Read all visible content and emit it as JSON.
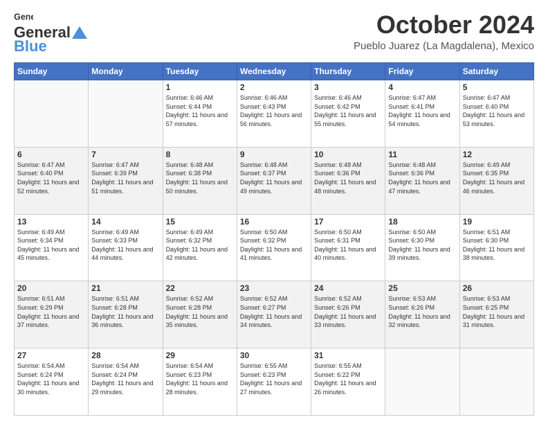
{
  "header": {
    "logo_general": "General",
    "logo_blue": "Blue",
    "month_title": "October 2024",
    "subtitle": "Pueblo Juarez (La Magdalena), Mexico"
  },
  "weekdays": [
    "Sunday",
    "Monday",
    "Tuesday",
    "Wednesday",
    "Thursday",
    "Friday",
    "Saturday"
  ],
  "weeks": [
    [
      {
        "day": "",
        "info": ""
      },
      {
        "day": "",
        "info": ""
      },
      {
        "day": "1",
        "info": "Sunrise: 6:46 AM\nSunset: 6:44 PM\nDaylight: 11 hours and 57 minutes."
      },
      {
        "day": "2",
        "info": "Sunrise: 6:46 AM\nSunset: 6:43 PM\nDaylight: 11 hours and 56 minutes."
      },
      {
        "day": "3",
        "info": "Sunrise: 6:46 AM\nSunset: 6:42 PM\nDaylight: 11 hours and 55 minutes."
      },
      {
        "day": "4",
        "info": "Sunrise: 6:47 AM\nSunset: 6:41 PM\nDaylight: 11 hours and 54 minutes."
      },
      {
        "day": "5",
        "info": "Sunrise: 6:47 AM\nSunset: 6:40 PM\nDaylight: 11 hours and 53 minutes."
      }
    ],
    [
      {
        "day": "6",
        "info": "Sunrise: 6:47 AM\nSunset: 6:40 PM\nDaylight: 11 hours and 52 minutes."
      },
      {
        "day": "7",
        "info": "Sunrise: 6:47 AM\nSunset: 6:39 PM\nDaylight: 11 hours and 51 minutes."
      },
      {
        "day": "8",
        "info": "Sunrise: 6:48 AM\nSunset: 6:38 PM\nDaylight: 11 hours and 50 minutes."
      },
      {
        "day": "9",
        "info": "Sunrise: 6:48 AM\nSunset: 6:37 PM\nDaylight: 11 hours and 49 minutes."
      },
      {
        "day": "10",
        "info": "Sunrise: 6:48 AM\nSunset: 6:36 PM\nDaylight: 11 hours and 48 minutes."
      },
      {
        "day": "11",
        "info": "Sunrise: 6:48 AM\nSunset: 6:36 PM\nDaylight: 11 hours and 47 minutes."
      },
      {
        "day": "12",
        "info": "Sunrise: 6:49 AM\nSunset: 6:35 PM\nDaylight: 11 hours and 46 minutes."
      }
    ],
    [
      {
        "day": "13",
        "info": "Sunrise: 6:49 AM\nSunset: 6:34 PM\nDaylight: 11 hours and 45 minutes."
      },
      {
        "day": "14",
        "info": "Sunrise: 6:49 AM\nSunset: 6:33 PM\nDaylight: 11 hours and 44 minutes."
      },
      {
        "day": "15",
        "info": "Sunrise: 6:49 AM\nSunset: 6:32 PM\nDaylight: 11 hours and 42 minutes."
      },
      {
        "day": "16",
        "info": "Sunrise: 6:50 AM\nSunset: 6:32 PM\nDaylight: 11 hours and 41 minutes."
      },
      {
        "day": "17",
        "info": "Sunrise: 6:50 AM\nSunset: 6:31 PM\nDaylight: 11 hours and 40 minutes."
      },
      {
        "day": "18",
        "info": "Sunrise: 6:50 AM\nSunset: 6:30 PM\nDaylight: 11 hours and 39 minutes."
      },
      {
        "day": "19",
        "info": "Sunrise: 6:51 AM\nSunset: 6:30 PM\nDaylight: 11 hours and 38 minutes."
      }
    ],
    [
      {
        "day": "20",
        "info": "Sunrise: 6:51 AM\nSunset: 6:29 PM\nDaylight: 11 hours and 37 minutes."
      },
      {
        "day": "21",
        "info": "Sunrise: 6:51 AM\nSunset: 6:28 PM\nDaylight: 11 hours and 36 minutes."
      },
      {
        "day": "22",
        "info": "Sunrise: 6:52 AM\nSunset: 6:28 PM\nDaylight: 11 hours and 35 minutes."
      },
      {
        "day": "23",
        "info": "Sunrise: 6:52 AM\nSunset: 6:27 PM\nDaylight: 11 hours and 34 minutes."
      },
      {
        "day": "24",
        "info": "Sunrise: 6:52 AM\nSunset: 6:26 PM\nDaylight: 11 hours and 33 minutes."
      },
      {
        "day": "25",
        "info": "Sunrise: 6:53 AM\nSunset: 6:26 PM\nDaylight: 11 hours and 32 minutes."
      },
      {
        "day": "26",
        "info": "Sunrise: 6:53 AM\nSunset: 6:25 PM\nDaylight: 11 hours and 31 minutes."
      }
    ],
    [
      {
        "day": "27",
        "info": "Sunrise: 6:54 AM\nSunset: 6:24 PM\nDaylight: 11 hours and 30 minutes."
      },
      {
        "day": "28",
        "info": "Sunrise: 6:54 AM\nSunset: 6:24 PM\nDaylight: 11 hours and 29 minutes."
      },
      {
        "day": "29",
        "info": "Sunrise: 6:54 AM\nSunset: 6:23 PM\nDaylight: 11 hours and 28 minutes."
      },
      {
        "day": "30",
        "info": "Sunrise: 6:55 AM\nSunset: 6:23 PM\nDaylight: 11 hours and 27 minutes."
      },
      {
        "day": "31",
        "info": "Sunrise: 6:55 AM\nSunset: 6:22 PM\nDaylight: 11 hours and 26 minutes."
      },
      {
        "day": "",
        "info": ""
      },
      {
        "day": "",
        "info": ""
      }
    ]
  ]
}
